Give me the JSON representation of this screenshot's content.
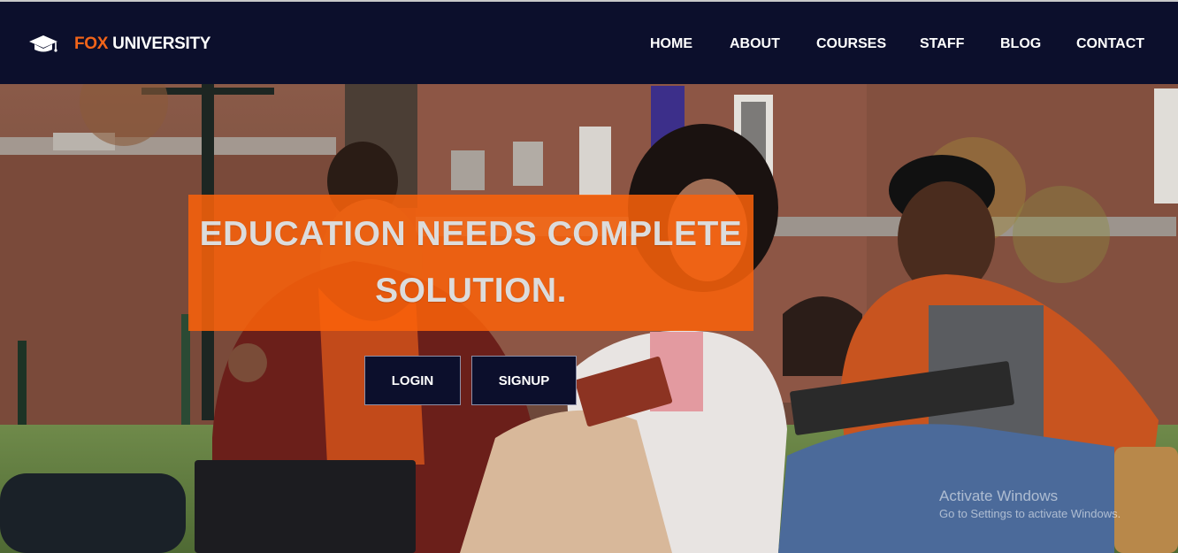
{
  "brand": {
    "icon": "graduation-cap-icon",
    "name_part1": "FOX",
    "name_part2": " UNIVERSITY",
    "accent_color": "#f26419"
  },
  "nav": {
    "items": [
      {
        "label": "HOME"
      },
      {
        "label": "ABOUT"
      },
      {
        "label": "COURSES"
      },
      {
        "label": "STAFF"
      },
      {
        "label": "BLOG"
      },
      {
        "label": "CONTACT"
      }
    ],
    "background_color": "#0c0f2c"
  },
  "hero": {
    "title": "EDUCATION NEEDS COMPLETE SOLUTION.",
    "banner_color": "#fa620a",
    "login_label": "LOGIN",
    "signup_label": "SIGNUP"
  },
  "watermark": {
    "title": "Activate Windows",
    "subtitle": "Go to Settings to activate Windows."
  }
}
